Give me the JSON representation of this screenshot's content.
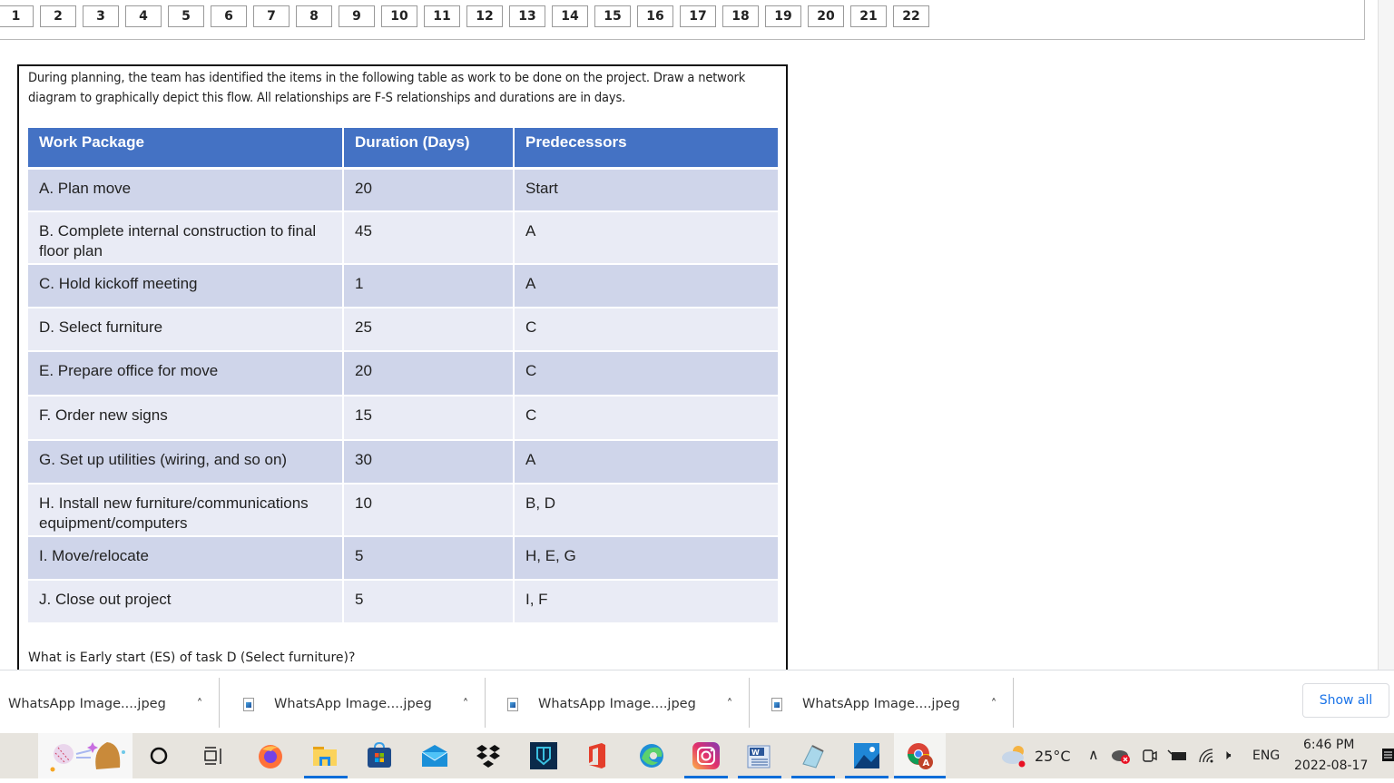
{
  "pager": {
    "pages": [
      "1",
      "2",
      "3",
      "4",
      "5",
      "6",
      "7",
      "8",
      "9",
      "10",
      "11",
      "12",
      "13",
      "14",
      "15",
      "16",
      "17",
      "18",
      "19",
      "20",
      "21",
      "22"
    ]
  },
  "question": {
    "intro": "During planning, the team has identified the items in the following table as work to be done on the project. Draw a network diagram to graphically depict this flow. All relationships are F-S relationships and durations are in days.",
    "table": {
      "headers": [
        "Work Package",
        "Duration (Days)",
        "Predecessors"
      ],
      "rows": [
        {
          "work_package": "A. Plan move",
          "duration": "20",
          "predecessors": "Start"
        },
        {
          "work_package": "B. Complete internal construction to final floor plan",
          "duration": "45",
          "predecessors": "A"
        },
        {
          "work_package": "C. Hold kickoff meeting",
          "duration": "1",
          "predecessors": "A"
        },
        {
          "work_package": "D. Select furniture",
          "duration": "25",
          "predecessors": "C"
        },
        {
          "work_package": "E. Prepare office for move",
          "duration": "20",
          "predecessors": "C"
        },
        {
          "work_package": "F. Order new signs",
          "duration": "15",
          "predecessors": "C"
        },
        {
          "work_package": "G. Set up utilities (wiring, and so on)",
          "duration": "30",
          "predecessors": "A"
        },
        {
          "work_package": "H. Install new furniture/communications equipment/computers",
          "duration": "10",
          "predecessors": "B, D"
        },
        {
          "work_package": "I. Move/relocate",
          "duration": "5",
          "predecessors": "H, E, G"
        },
        {
          "work_package": "J. Close out project",
          "duration": "5",
          "predecessors": "I, F"
        }
      ]
    },
    "ask": "What is Early start (ES) of task D (Select furniture)?"
  },
  "downloads": {
    "items": [
      {
        "name": "WhatsApp Image....jpeg"
      },
      {
        "name": "WhatsApp Image....jpeg"
      },
      {
        "name": "WhatsApp Image....jpeg"
      },
      {
        "name": "WhatsApp Image....jpeg"
      }
    ],
    "show_all": "Show all"
  },
  "taskbar": {
    "weather": "25°C",
    "language": "ENG",
    "time": "6:46 PM",
    "date": "2022-08-17",
    "apps": [
      "search",
      "task-view",
      "firefox",
      "file-explorer",
      "microsoft-store",
      "mail",
      "dropbox",
      "app-shield",
      "office",
      "edge",
      "instagram",
      "word",
      "notepad",
      "photos",
      "chrome"
    ]
  },
  "colors": {
    "header_blue": "#4472c4",
    "row_dark": "#cfd5ea",
    "row_light": "#e9ebf5",
    "link_blue": "#1a73e8"
  }
}
